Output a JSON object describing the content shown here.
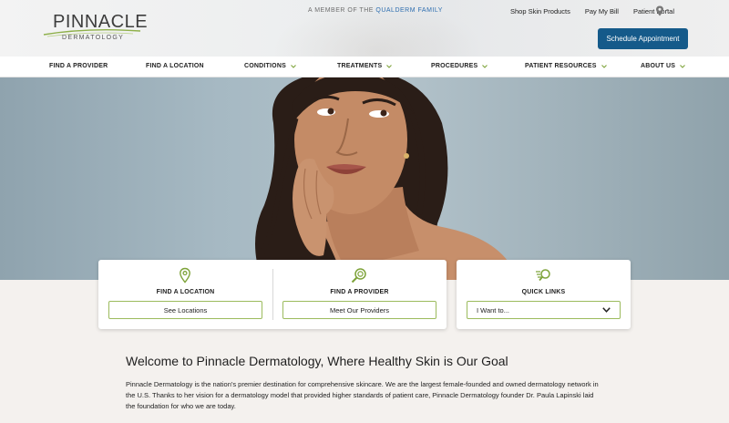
{
  "header": {
    "logo_main": "PINNACLE",
    "logo_sub": "DERMATOLOGY",
    "member_prefix": "A MEMBER OF THE",
    "member_brand": "QUALDERM FAMILY",
    "links": [
      "Shop Skin Products",
      "Pay My Bill",
      "Patient Portal"
    ],
    "location_text": "-",
    "schedule_label": "Schedule Appointment"
  },
  "nav": {
    "items": [
      {
        "label": "FIND A PROVIDER",
        "has_dropdown": false
      },
      {
        "label": "FIND A LOCATION",
        "has_dropdown": false
      },
      {
        "label": "CONDITIONS",
        "has_dropdown": true
      },
      {
        "label": "TREATMENTS",
        "has_dropdown": true
      },
      {
        "label": "PROCEDURES",
        "has_dropdown": true
      },
      {
        "label": "PATIENT RESOURCES",
        "has_dropdown": true
      },
      {
        "label": "ABOUT US",
        "has_dropdown": true
      }
    ]
  },
  "cards": {
    "location": {
      "title": "FIND A LOCATION",
      "button": "See Locations",
      "icon": "location-pin-icon"
    },
    "provider": {
      "title": "FIND A PROVIDER",
      "button": "Meet Our Providers",
      "icon": "provider-search-icon"
    },
    "quick_links": {
      "title": "QUICK LINKS",
      "select_value": "I Want to...",
      "icon": "quick-links-icon"
    }
  },
  "welcome": {
    "heading": "Welcome to Pinnacle Dermatology, Where Healthy Skin is Our Goal",
    "paragraph": "Pinnacle Dermatology is the nation's premier destination for comprehensive skincare. We are the largest female-founded and owned dermatology network in the U.S. Thanks to her vision for a dermatology model that provided higher standards of patient care, Pinnacle Dermatology founder Dr. Paula Lapinski laid the foundation for who we are today."
  },
  "colors": {
    "accent_blue": "#155a8a",
    "accent_green": "#7ea33a",
    "link_blue": "#2f6fb0"
  }
}
